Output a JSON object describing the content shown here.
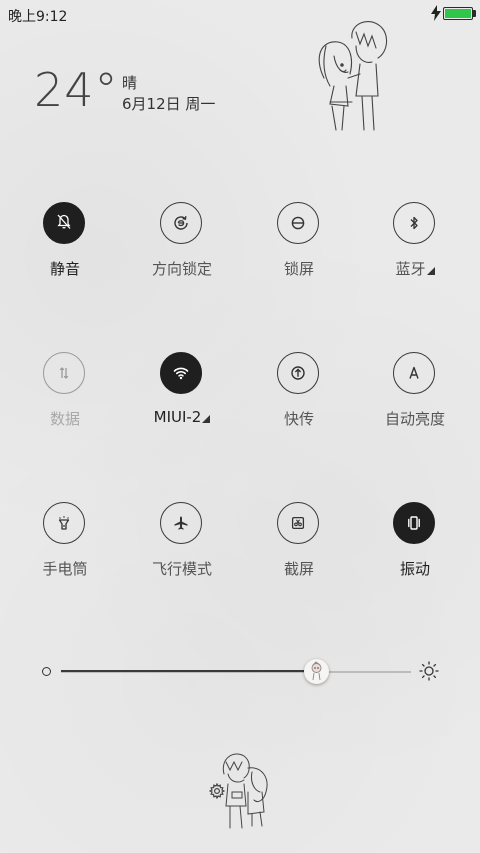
{
  "status_bar": {
    "time": "晚上9:12",
    "battery_color": "#2fc64a"
  },
  "weather": {
    "temperature": "24°",
    "condition": "晴",
    "date": "6月12日 周一"
  },
  "rows": [
    [
      {
        "label": "静音",
        "icon": "mute-bell-icon",
        "state": "active"
      },
      {
        "label": "方向锁定",
        "icon": "rotation-lock-icon",
        "state": "off"
      },
      {
        "label": "锁屏",
        "icon": "lock-screen-icon",
        "state": "off"
      },
      {
        "label": "蓝牙",
        "icon": "bluetooth-icon",
        "state": "off"
      }
    ],
    [
      {
        "label": "数据",
        "icon": "mobile-data-icon",
        "state": "disabled"
      },
      {
        "label": "MIUI-2",
        "icon": "wifi-icon",
        "state": "active"
      },
      {
        "label": "快传",
        "icon": "quick-transfer-icon",
        "state": "off"
      },
      {
        "label": "自动亮度",
        "icon": "auto-brightness-icon",
        "state": "off"
      }
    ],
    [
      {
        "label": "手电筒",
        "icon": "flashlight-icon",
        "state": "off"
      },
      {
        "label": "飞行模式",
        "icon": "airplane-icon",
        "state": "off"
      },
      {
        "label": "截屏",
        "icon": "screenshot-icon",
        "state": "off"
      },
      {
        "label": "振动",
        "icon": "vibrate-icon",
        "state": "active"
      }
    ]
  ],
  "brightness": {
    "level": 0.73
  }
}
